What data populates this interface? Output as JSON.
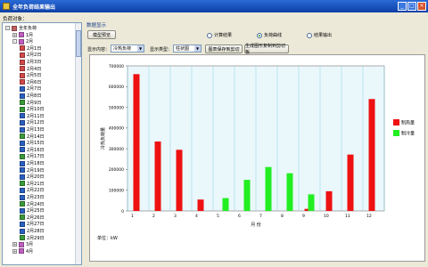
{
  "window": {
    "title": "全年负荷结果输出",
    "buttons": [
      "_",
      "□",
      "×"
    ]
  },
  "left": {
    "label": "负荷对象：",
    "tree": [
      {
        "text": "全年负荷",
        "depth": 0,
        "exp": "-",
        "icon": "#c06060"
      },
      {
        "text": "1月",
        "depth": 1,
        "exp": "+",
        "icon": "#c060c0"
      },
      {
        "text": "2月",
        "depth": 1,
        "exp": "-",
        "icon": "#c060c0"
      },
      {
        "text": "2月1日",
        "depth": 2,
        "exp": "",
        "icon": "#d24a4a"
      },
      {
        "text": "2月2日",
        "depth": 2,
        "exp": "",
        "icon": "#d24a4a"
      },
      {
        "text": "2月3日",
        "depth": 2,
        "exp": "",
        "icon": "#d24a4a"
      },
      {
        "text": "2月4日",
        "depth": 2,
        "exp": "",
        "icon": "#d24a4a"
      },
      {
        "text": "2月5日",
        "depth": 2,
        "exp": "",
        "icon": "#d24a4a"
      },
      {
        "text": "2月6日",
        "depth": 2,
        "exp": "",
        "icon": "#d24a4a"
      },
      {
        "text": "2月7日",
        "depth": 2,
        "exp": "",
        "icon": "#2a60c0"
      },
      {
        "text": "2月8日",
        "depth": 2,
        "exp": "",
        "icon": "#2a60c0"
      },
      {
        "text": "2月9日",
        "depth": 2,
        "exp": "",
        "icon": "#3a9a3a"
      },
      {
        "text": "2月10日",
        "depth": 2,
        "exp": "",
        "icon": "#3a9a3a"
      },
      {
        "text": "2月11日",
        "depth": 2,
        "exp": "",
        "icon": "#2a60c0"
      },
      {
        "text": "2月12日",
        "depth": 2,
        "exp": "",
        "icon": "#2a60c0"
      },
      {
        "text": "2月13日",
        "depth": 2,
        "exp": "",
        "icon": "#2a60c0"
      },
      {
        "text": "2月14日",
        "depth": 2,
        "exp": "",
        "icon": "#3a9a3a"
      },
      {
        "text": "2月15日",
        "depth": 2,
        "exp": "",
        "icon": "#2a60c0"
      },
      {
        "text": "2月16日",
        "depth": 2,
        "exp": "",
        "icon": "#2a60c0"
      },
      {
        "text": "2月17日",
        "depth": 2,
        "exp": "",
        "icon": "#3a9a3a"
      },
      {
        "text": "2月18日",
        "depth": 2,
        "exp": "",
        "icon": "#2a60c0"
      },
      {
        "text": "2月19日",
        "depth": 2,
        "exp": "",
        "icon": "#2a60c0"
      },
      {
        "text": "2月20日",
        "depth": 2,
        "exp": "",
        "icon": "#2a60c0"
      },
      {
        "text": "2月21日",
        "depth": 2,
        "exp": "",
        "icon": "#3a9a3a"
      },
      {
        "text": "2月22日",
        "depth": 2,
        "exp": "",
        "icon": "#2a60c0"
      },
      {
        "text": "2月23日",
        "depth": 2,
        "exp": "",
        "icon": "#2a60c0"
      },
      {
        "text": "2月24日",
        "depth": 2,
        "exp": "",
        "icon": "#3a9a3a"
      },
      {
        "text": "2月25日",
        "depth": 2,
        "exp": "",
        "icon": "#2a60c0"
      },
      {
        "text": "2月26日",
        "depth": 2,
        "exp": "",
        "icon": "#3a9a3a"
      },
      {
        "text": "2月27日",
        "depth": 2,
        "exp": "",
        "icon": "#2a60c0"
      },
      {
        "text": "2月28日",
        "depth": 2,
        "exp": "",
        "icon": "#2a60c0"
      },
      {
        "text": "2月29日",
        "depth": 2,
        "exp": "",
        "icon": "#3a9a3a"
      },
      {
        "text": "3月",
        "depth": 1,
        "exp": "+",
        "icon": "#c060c0"
      },
      {
        "text": "4月",
        "depth": 1,
        "exp": "+",
        "icon": "#c060c0"
      }
    ]
  },
  "right": {
    "section_title": "数据显示",
    "model_button": "模型预览",
    "radios": [
      {
        "label": "计算结果",
        "checked": false
      },
      {
        "label": "负荷曲线",
        "checked": true
      },
      {
        "label": "结果输出",
        "checked": false
      }
    ],
    "display_content_label": "显示内容：",
    "display_content_value": "冷热负荷",
    "display_type_label": "显示类型：",
    "display_type_value": "柱状图",
    "save_image_button": "图表保存到剪切",
    "copy_button": "生成图形复制到剪切板"
  },
  "chart_data": {
    "type": "bar",
    "categories": [
      "1",
      "2",
      "3",
      "4",
      "5",
      "6",
      "7",
      "8",
      "9",
      "10",
      "11",
      "12"
    ],
    "series": [
      {
        "name": "制热量",
        "color": "#ee1111",
        "values": [
          660000,
          335000,
          295000,
          55000,
          0,
          0,
          0,
          0,
          10000,
          95000,
          272000,
          540000
        ]
      },
      {
        "name": "制冷量",
        "color": "#22ee22",
        "values": [
          0,
          0,
          0,
          0,
          62000,
          150000,
          212000,
          182000,
          80000,
          0,
          0,
          0
        ]
      }
    ],
    "ylim": [
      0,
      700000
    ],
    "yticks": [
      "700000",
      "600000",
      "500000",
      "400000",
      "300000",
      "200000",
      "100000",
      "0"
    ],
    "xlabel": "月 份",
    "ylabel": "冷热负荷量",
    "unit_note": "单位：kW",
    "grid": true,
    "legend": "right"
  }
}
